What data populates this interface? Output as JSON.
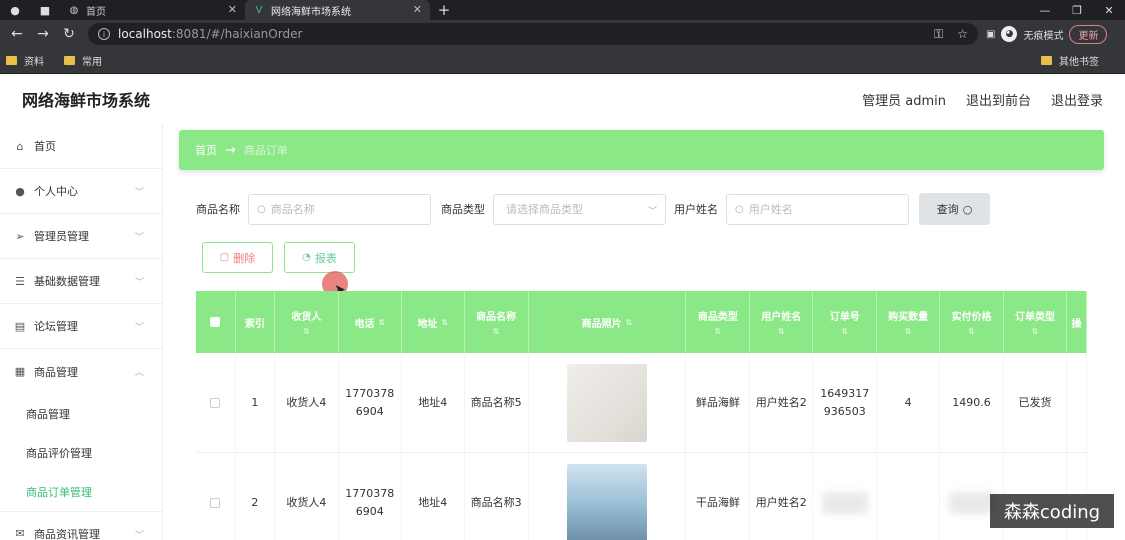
{
  "browser": {
    "tabs": [
      {
        "label": "首页"
      },
      {
        "label": "网络海鲜市场系统"
      }
    ],
    "url_host": "localhost",
    "url_path": ":8081/#/haixianOrder",
    "incognito_label": "无痕模式",
    "update_label": "更新",
    "bookmarks": [
      {
        "label": "资料"
      },
      {
        "label": "常用"
      }
    ],
    "other_bookmarks": "其他书签"
  },
  "header": {
    "title": "网络海鲜市场系统",
    "admin": "管理员 admin",
    "to_frontend": "退出到前台",
    "logout": "退出登录"
  },
  "sidebar": {
    "items": [
      {
        "label": "首页",
        "icon": "home-icon"
      },
      {
        "label": "个人中心",
        "icon": "user-icon"
      },
      {
        "label": "管理员管理",
        "icon": "send-icon"
      },
      {
        "label": "基础数据管理",
        "icon": "sliders-icon"
      },
      {
        "label": "论坛管理",
        "icon": "doc-icon"
      },
      {
        "label": "商品管理",
        "icon": "grid-icon"
      }
    ],
    "subitems": [
      {
        "label": "商品管理"
      },
      {
        "label": "商品评价管理"
      },
      {
        "label": "商品订单管理"
      }
    ],
    "last_item": {
      "label": "商品资讯管理",
      "icon": "mail-icon"
    }
  },
  "breadcrumb": {
    "home": "首页",
    "current": "商品订单"
  },
  "filters": {
    "name_label": "商品名称",
    "name_placeholder": "商品名称",
    "type_label": "商品类型",
    "type_placeholder": "请选择商品类型",
    "user_label": "用户姓名",
    "user_placeholder": "用户姓名",
    "query_label": "查询"
  },
  "actions": {
    "delete_label": "删除",
    "report_label": "报表"
  },
  "table": {
    "headers": [
      "索引",
      "收货人",
      "电话",
      "地址",
      "商品名称",
      "商品照片",
      "商品类型",
      "用户姓名",
      "订单号",
      "购买数量",
      "实付价格",
      "订单类型",
      "操"
    ],
    "rows": [
      {
        "index": "1",
        "receiver": "收货人4",
        "phone": "17703786904",
        "address": "地址4",
        "product": "商品名称5",
        "type": "鲜品海鲜",
        "user": "用户姓名2",
        "order_no": "1649317936503",
        "qty": "4",
        "price": "1490.6",
        "status": "已发货"
      },
      {
        "index": "2",
        "receiver": "收货人4",
        "phone": "17703786904",
        "address": "地址4",
        "product": "商品名称3",
        "type": "干品海鲜",
        "user": "用户姓名2"
      }
    ]
  },
  "watermark": "森森coding",
  "colors": {
    "accent_green": "#8ae886",
    "active_menu": "#3cb878"
  }
}
